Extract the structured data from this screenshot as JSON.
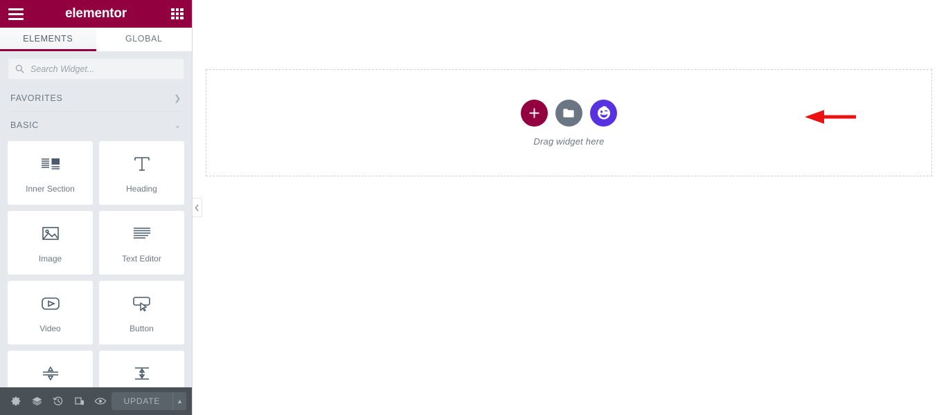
{
  "app": {
    "brand": "elementor",
    "menu_icon": "hamburger-menu-icon",
    "apps_icon": "apps-grid-icon"
  },
  "tabs": [
    {
      "label": "ELEMENTS",
      "active": true
    },
    {
      "label": "GLOBAL",
      "active": false
    }
  ],
  "search": {
    "placeholder": "Search Widget...",
    "value": "",
    "icon": "search-icon"
  },
  "sections": [
    {
      "label": "FAVORITES",
      "state": "collapsed",
      "chevron": "❯"
    },
    {
      "label": "BASIC",
      "state": "expanded",
      "chevron": "⌄"
    }
  ],
  "widgets": [
    {
      "label": "Inner Section",
      "icon": "inner-section-icon"
    },
    {
      "label": "Heading",
      "icon": "heading-icon"
    },
    {
      "label": "Image",
      "icon": "image-icon"
    },
    {
      "label": "Text Editor",
      "icon": "text-editor-icon"
    },
    {
      "label": "Video",
      "icon": "video-icon"
    },
    {
      "label": "Button",
      "icon": "button-icon"
    },
    {
      "label": "Divider",
      "icon": "divider-icon"
    },
    {
      "label": "Spacer",
      "icon": "spacer-icon"
    }
  ],
  "footer": {
    "icons": [
      {
        "name": "settings-gear-icon",
        "title": "Settings"
      },
      {
        "name": "navigator-layers-icon",
        "title": "Navigator"
      },
      {
        "name": "history-clock-icon",
        "title": "History"
      },
      {
        "name": "responsive-device-icon",
        "title": "Responsive Mode"
      },
      {
        "name": "preview-eye-icon",
        "title": "Preview Changes"
      }
    ],
    "update_label": "UPDATE",
    "caret": "▲"
  },
  "canvas": {
    "drag_label": "Drag widget here",
    "buttons": [
      {
        "name": "add-new-section-button",
        "icon": "plus-icon",
        "color": "#93003f"
      },
      {
        "name": "add-template-button",
        "icon": "folder-icon",
        "color": "#6b7684"
      },
      {
        "name": "happy-addons-button",
        "icon": "happy-face-icon",
        "color": "#5832e0"
      }
    ]
  },
  "annotation": {
    "arrow": "left-pointing-arrow",
    "color": "#ee1111"
  },
  "collapse": {
    "icon": "chevron-left-icon"
  },
  "colors": {
    "brand": "#93003f",
    "panel_bg": "#e5e8ed",
    "footer_bg": "#495157",
    "happy_purple": "#5832e0",
    "dashed_border": "#c9d0d8",
    "annotation_red": "#ee1111"
  }
}
